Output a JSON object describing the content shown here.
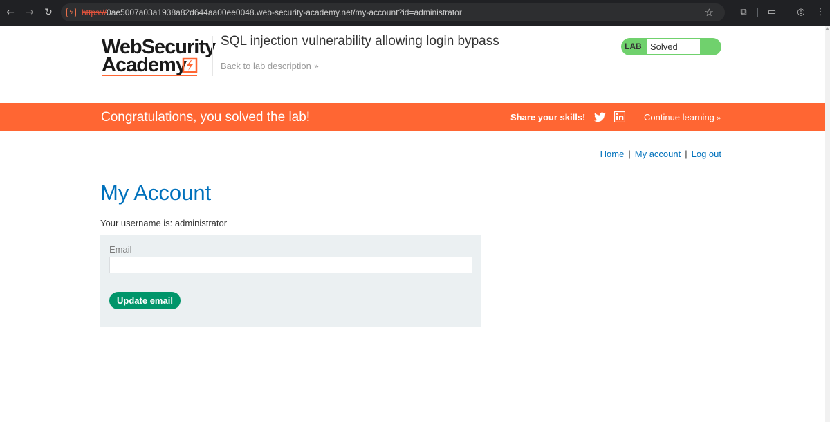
{
  "browser": {
    "url_scheme": "https://",
    "url_rest": "0ae5007a03a1938a82d644aa00ee0048.web-security-academy.net/my-account?id=administrator",
    "back_icon": "back-arrow-icon",
    "forward_icon": "forward-arrow-icon",
    "reload_icon": "reload-icon",
    "bookmark_icon": "star-icon"
  },
  "header": {
    "logo_line1": "WebSecurity",
    "logo_line2": "Academy",
    "lab_title": "SQL injection vulnerability allowing login bypass",
    "back_link": "Back to lab description",
    "back_chevron": "»",
    "lab_tag": "LAB",
    "lab_state": "Solved",
    "accent_color": "#ff6633",
    "status_color": "#70d16d"
  },
  "banner": {
    "message": "Congratulations, you solved the lab!",
    "share_label": "Share your skills!",
    "continue_label": "Continue learning",
    "continue_chevron": "»"
  },
  "top_nav": {
    "home": "Home",
    "separator": "|",
    "my_account": "My account",
    "log_out": "Log out"
  },
  "main": {
    "title": "My Account",
    "username_line": "Your username is: administrator",
    "email_label": "Email",
    "email_value": "",
    "update_button": "Update email"
  }
}
